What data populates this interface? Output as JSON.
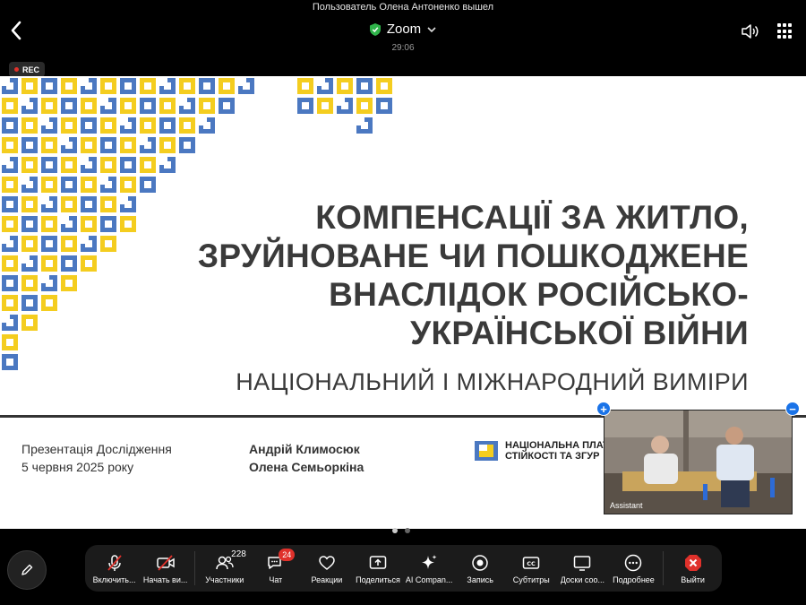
{
  "notification": "Пользователь Олена Антоненко вышел",
  "header": {
    "title": "Zoom",
    "timer": "29:06"
  },
  "rec_label": "REC",
  "slide": {
    "title_lines": [
      "КОМПЕНСАЦІЇ ЗА ЖИТЛО,",
      "ЗРУЙНОВАНЕ ЧИ ПОШКОДЖЕНЕ",
      "ВНАСЛІДОК РОСІЙСЬКО-",
      "УКРАЇНСЬКОЇ ВІЙНИ"
    ],
    "subtitle": "НАЦІОНАЛЬНИЙ І МІЖНАРОДНИЙ ВИМІРИ",
    "info_left": [
      "Презентація Дослідження",
      "5 червня 2025 року"
    ],
    "info_mid": [
      "Андрій Климосюк",
      "Олена Семьоркіна"
    ],
    "org_lines": [
      "НАЦІОНАЛЬНА ПЛАТ",
      "СТІЙКОСТІ ТА ЗГУР"
    ],
    "colors": {
      "blue": "#4b78c1",
      "yellow": "#f4cd1f"
    }
  },
  "video_tile": {
    "name": "Assistant"
  },
  "toolbar": {
    "mic": "Включить...",
    "video": "Начать ви...",
    "participants": "Участники",
    "participants_count": "228",
    "chat": "Чат",
    "chat_badge": "24",
    "reactions": "Реакции",
    "share": "Поделиться",
    "ai": "AI Compan...",
    "record": "Запись",
    "captions": "Субтитры",
    "whiteboards": "Доски соо...",
    "more": "Подробнее",
    "leave": "Выйти"
  }
}
